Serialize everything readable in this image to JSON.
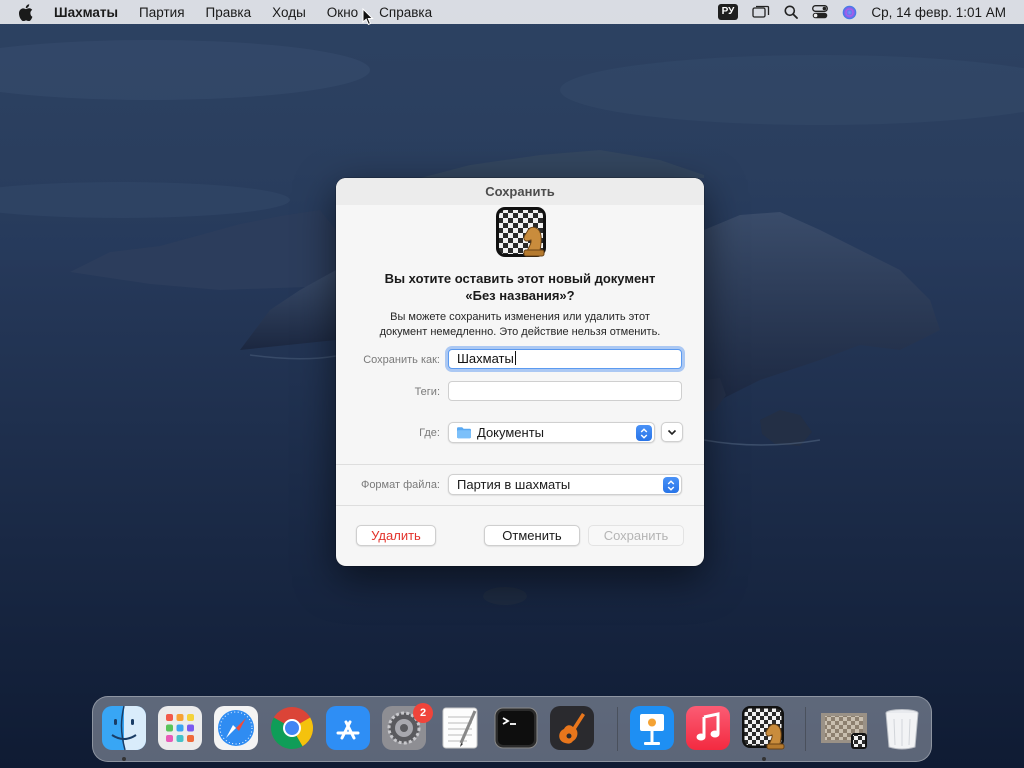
{
  "menubar": {
    "app_name": "Шахматы",
    "menus": [
      "Партия",
      "Правка",
      "Ходы",
      "Окно",
      "Справка"
    ],
    "input_source": "РУ",
    "clock": "Ср, 14 февр.  1:01 AM",
    "status_icons": [
      "mission-control-icon",
      "spotlight-search-icon",
      "control-center-icon",
      "siri-icon"
    ]
  },
  "dialog": {
    "title": "Сохранить",
    "headline_line1": "Вы хотите оставить этот новый документ",
    "headline_line2": "«Без названия»?",
    "message_line1": "Вы можете сохранить изменения или удалить этот",
    "message_line2": "документ немедленно. Это действие нельзя отменить.",
    "save_as_label": "Сохранить как:",
    "save_as_value": "Шахматы",
    "tags_label": "Теги:",
    "tags_value": "",
    "where_label": "Где:",
    "where_value": "Документы",
    "format_label": "Формат файла:",
    "format_value": "Партия в шахматы",
    "delete_label": "Удалить",
    "cancel_label": "Отменить",
    "save_label": "Сохранить"
  },
  "dock": {
    "apps": [
      "finder-icon",
      "launchpad-icon",
      "safari-icon",
      "chrome-icon",
      "app-store-icon",
      "system-preferences-icon",
      "textedit-icon",
      "terminal-icon",
      "garageband-icon",
      "keynote-icon",
      "music-icon",
      "chess-icon",
      "chess-window-thumbnail",
      "trash-icon"
    ],
    "system_preferences_badge": "2"
  },
  "colors": {
    "accent": "#2874e8",
    "destructive": "#e2322b",
    "badge": "#f0443a"
  }
}
